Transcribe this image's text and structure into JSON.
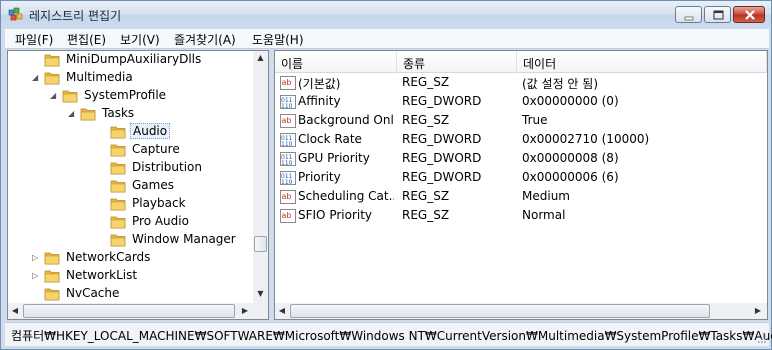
{
  "window": {
    "title": "레지스트리 편집기",
    "icons": {
      "app": "regedit-icon",
      "minimize": "minimize-icon",
      "maximize": "maximize-icon",
      "close": "close-icon"
    }
  },
  "menu": [
    "파일(F)",
    "편집(E)",
    "보기(V)",
    "즐겨찾기(A)",
    "도움말(H)"
  ],
  "tree": [
    {
      "label": "MiniDumpAuxiliaryDlls",
      "depth": 1,
      "expander": "",
      "selected": false
    },
    {
      "label": "Multimedia",
      "depth": 1,
      "expander": "expanded",
      "selected": false
    },
    {
      "label": "SystemProfile",
      "depth": 2,
      "expander": "expanded",
      "selected": false
    },
    {
      "label": "Tasks",
      "depth": 3,
      "expander": "expanded",
      "selected": false
    },
    {
      "label": "Audio",
      "depth": 4,
      "expander": "",
      "selected": true
    },
    {
      "label": "Capture",
      "depth": 4,
      "expander": "",
      "selected": false
    },
    {
      "label": "Distribution",
      "depth": 4,
      "expander": "",
      "selected": false
    },
    {
      "label": "Games",
      "depth": 4,
      "expander": "",
      "selected": false
    },
    {
      "label": "Playback",
      "depth": 4,
      "expander": "",
      "selected": false
    },
    {
      "label": "Pro Audio",
      "depth": 4,
      "expander": "",
      "selected": false
    },
    {
      "label": "Window Manager",
      "depth": 4,
      "expander": "",
      "selected": false
    },
    {
      "label": "NetworkCards",
      "depth": 1,
      "expander": "collapsed",
      "selected": false
    },
    {
      "label": "NetworkList",
      "depth": 1,
      "expander": "collapsed",
      "selected": false
    },
    {
      "label": "NvCache",
      "depth": 1,
      "expander": "",
      "selected": false
    }
  ],
  "columns": [
    "이름",
    "종류",
    "데이터"
  ],
  "values": [
    {
      "name": "(기본값)",
      "type": "REG_SZ",
      "data": "(값 설정 안 됨)",
      "icon": "string-value-icon"
    },
    {
      "name": "Affinity",
      "type": "REG_DWORD",
      "data": "0x00000000 (0)",
      "icon": "binary-value-icon"
    },
    {
      "name": "Background Only",
      "type": "REG_SZ",
      "data": "True",
      "icon": "string-value-icon"
    },
    {
      "name": "Clock Rate",
      "type": "REG_DWORD",
      "data": "0x00002710 (10000)",
      "icon": "binary-value-icon"
    },
    {
      "name": "GPU Priority",
      "type": "REG_DWORD",
      "data": "0x00000008 (8)",
      "icon": "binary-value-icon"
    },
    {
      "name": "Priority",
      "type": "REG_DWORD",
      "data": "0x00000006 (6)",
      "icon": "binary-value-icon"
    },
    {
      "name": "Scheduling Cat...",
      "type": "REG_SZ",
      "data": "Medium",
      "icon": "string-value-icon"
    },
    {
      "name": "SFIO Priority",
      "type": "REG_SZ",
      "data": "Normal",
      "icon": "string-value-icon"
    }
  ],
  "status": "컴퓨터₩HKEY_LOCAL_MACHINE₩SOFTWARE₩Microsoft₩Windows NT₩CurrentVersion₩Multimedia₩SystemProfile₩Tasks₩Audio",
  "scroll": {
    "tree_vertical_position": 0.82
  },
  "colors": {
    "close_button": "#c9473a",
    "selection_border": "#7da2ce",
    "folder": "#e8b93a"
  }
}
